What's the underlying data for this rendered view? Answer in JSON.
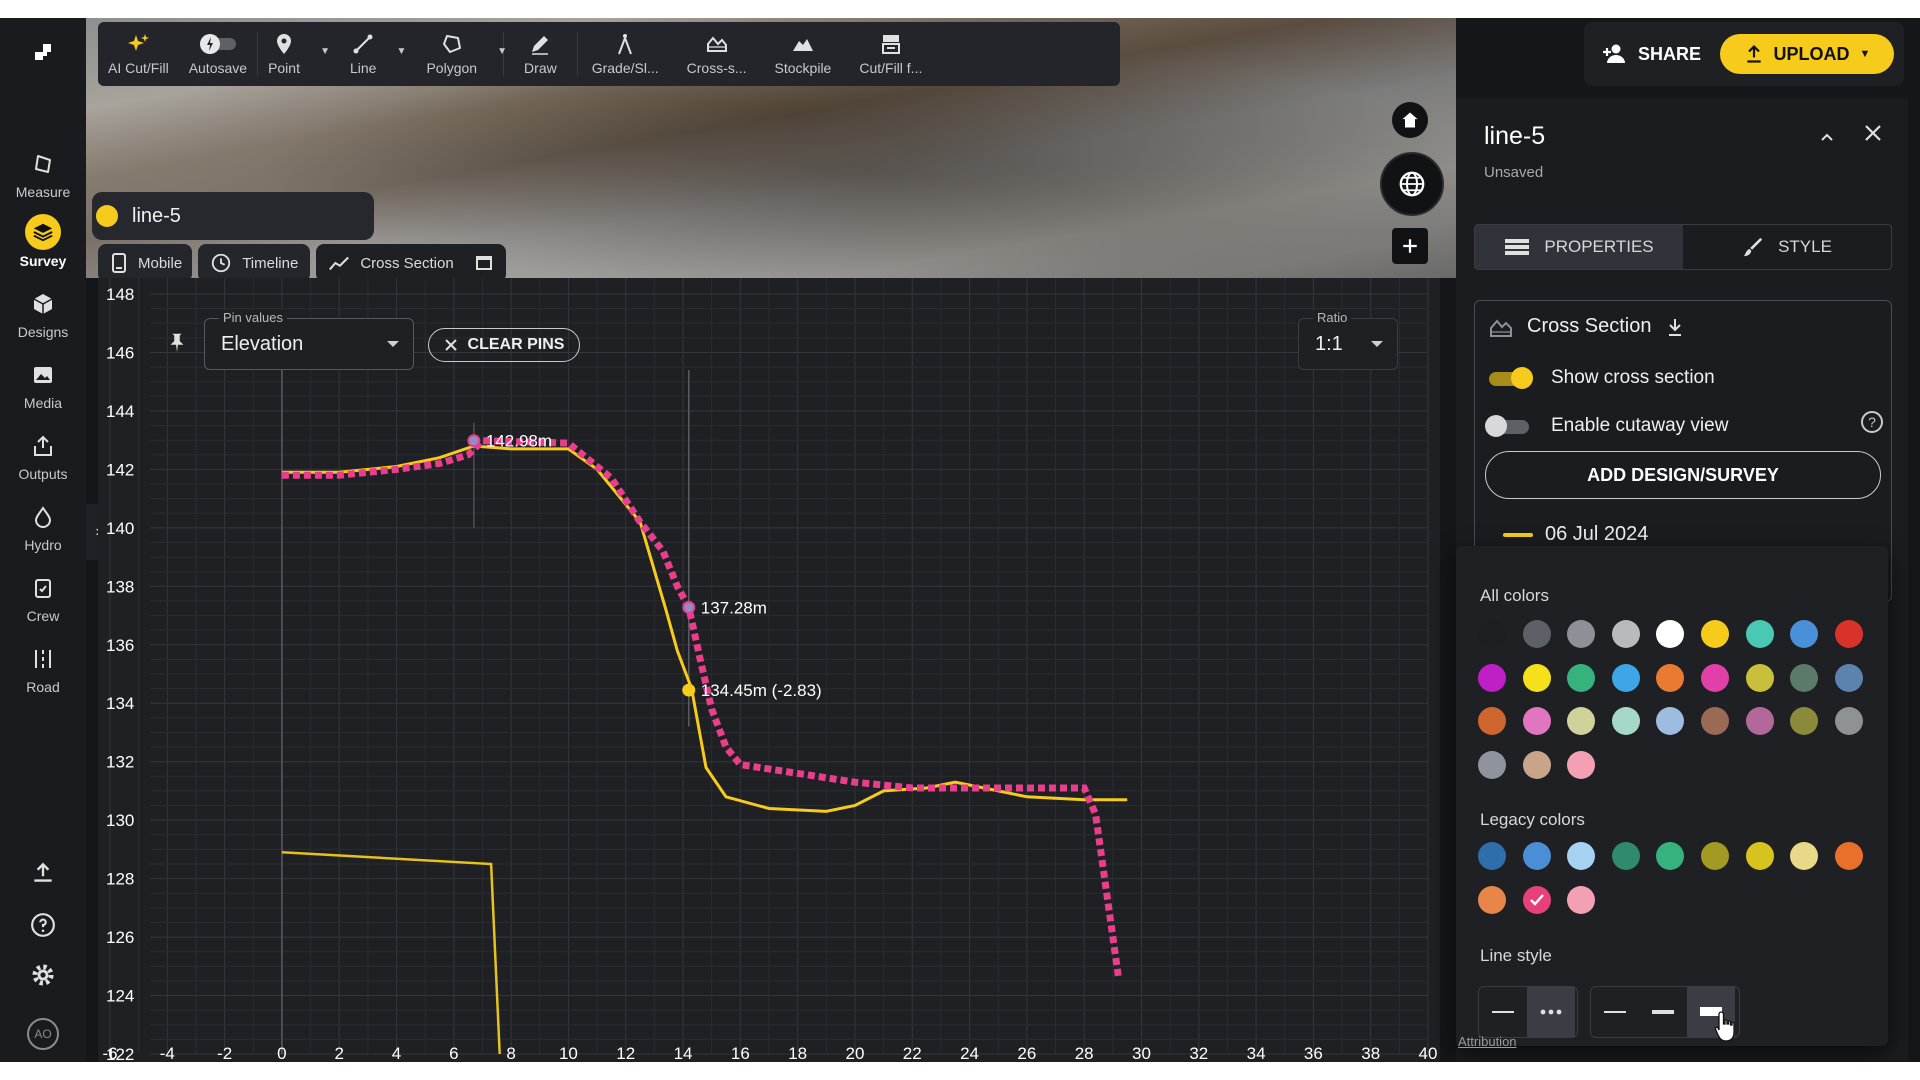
{
  "sidebar": {
    "items": [
      {
        "label": "Measure",
        "icon": "measure-icon"
      },
      {
        "label": "Survey",
        "icon": "survey-layers-icon",
        "active": true
      },
      {
        "label": "Designs",
        "icon": "designs-cube-icon"
      },
      {
        "label": "Media",
        "icon": "media-image-icon"
      },
      {
        "label": "Outputs",
        "icon": "outputs-export-icon"
      },
      {
        "label": "Hydro",
        "icon": "hydro-drop-icon"
      },
      {
        "label": "Crew",
        "icon": "crew-clipboard-icon"
      },
      {
        "label": "Road",
        "icon": "road-icon"
      }
    ],
    "avatar_initials": "AO"
  },
  "toolbar": {
    "tools": [
      {
        "label": "AI Cut/Fill",
        "icon": "sparkle-icon"
      },
      {
        "label": "Autosave",
        "icon": "autosave-toggle-icon"
      },
      {
        "label": "Point",
        "icon": "map-pin-icon"
      },
      {
        "label": "Line",
        "icon": "line-icon"
      },
      {
        "label": "Polygon",
        "icon": "polygon-icon"
      },
      {
        "label": "Draw",
        "icon": "pencil-icon"
      },
      {
        "label": "Grade/Sl...",
        "icon": "compass-icon"
      },
      {
        "label": "Cross-s...",
        "icon": "cross-section-icon"
      },
      {
        "label": "Stockpile",
        "icon": "stockpile-icon"
      },
      {
        "label": "Cut/Fill f...",
        "icon": "cutfill-icon"
      }
    ]
  },
  "header": {
    "share_label": "SHARE",
    "upload_label": "UPLOAD",
    "accent_color": "#f6cb1c"
  },
  "layer": {
    "name": "line-5",
    "color": "#f6cb1c"
  },
  "viewer_tabs": [
    {
      "label": "Mobile",
      "icon": "mobile-icon"
    },
    {
      "label": "Timeline",
      "icon": "clock-icon"
    },
    {
      "label": "Cross Section",
      "icon": "chart-line-icon"
    }
  ],
  "cross_section": {
    "pin_values_label": "Pin values",
    "pin_values_value": "Elevation",
    "clear_pins_label": "CLEAR PINS",
    "ratio_label": "Ratio",
    "ratio_value": "1:1"
  },
  "chart_data": {
    "type": "line",
    "xlim": [
      -6,
      40
    ],
    "ylim": [
      122,
      148
    ],
    "x_ticks": [
      "-6",
      "-4",
      "-2",
      "0",
      "2",
      "4",
      "6",
      "8",
      "10",
      "12",
      "14",
      "16",
      "18",
      "20",
      "22",
      "24",
      "26",
      "28",
      "30",
      "32",
      "34",
      "36",
      "38",
      "40"
    ],
    "y_ticks": [
      "122",
      "124",
      "126",
      "128",
      "130",
      "132",
      "134",
      "136",
      "138",
      "140",
      "142",
      "144",
      "146",
      "148"
    ],
    "grid": true,
    "series": [
      {
        "color": "#f6cb1c",
        "style": "solid",
        "points": [
          [
            0,
            141.9
          ],
          [
            2,
            141.9
          ],
          [
            4,
            142.1
          ],
          [
            5.5,
            142.4
          ],
          [
            6.7,
            142.8
          ],
          [
            8,
            142.7
          ],
          [
            10,
            142.7
          ],
          [
            11,
            142.0
          ],
          [
            12.5,
            140.2
          ],
          [
            13.4,
            137.2
          ],
          [
            13.8,
            135.8
          ],
          [
            14.3,
            134.5
          ],
          [
            14.8,
            131.8
          ],
          [
            15.5,
            130.8
          ],
          [
            17,
            130.4
          ],
          [
            19,
            130.3
          ],
          [
            20,
            130.5
          ],
          [
            21,
            131.0
          ],
          [
            22.5,
            131.1
          ],
          [
            23.5,
            131.3
          ],
          [
            25,
            131.0
          ],
          [
            26,
            130.8
          ],
          [
            28,
            130.7
          ],
          [
            29.5,
            130.7
          ]
        ]
      },
      {
        "color": "#e83e8c",
        "style": "dashed",
        "points": [
          [
            0,
            141.8
          ],
          [
            2,
            141.8
          ],
          [
            4,
            142.0
          ],
          [
            5.5,
            142.2
          ],
          [
            6.5,
            142.5
          ],
          [
            7,
            142.98
          ],
          [
            10,
            142.9
          ],
          [
            11.5,
            141.7
          ],
          [
            12.5,
            140.2
          ],
          [
            13.3,
            139.2
          ],
          [
            13.8,
            138.0
          ],
          [
            14.2,
            137.28
          ],
          [
            14.6,
            135.5
          ],
          [
            15,
            133.8
          ],
          [
            15.5,
            132.5
          ],
          [
            16,
            131.9
          ],
          [
            18,
            131.6
          ],
          [
            20,
            131.3
          ],
          [
            22,
            131.1
          ],
          [
            25,
            131.1
          ],
          [
            28,
            131.1
          ],
          [
            28.4,
            130.2
          ],
          [
            29.2,
            124.6
          ]
        ]
      },
      {
        "color": "#e6c21a",
        "style": "solid",
        "points": [
          [
            0,
            128.9
          ],
          [
            7.3,
            128.5
          ],
          [
            7.6,
            122
          ]
        ]
      }
    ],
    "pins": [
      {
        "x": 6.7,
        "y": 142.98,
        "label": "142.98m",
        "color": "#e83e8c"
      },
      {
        "x": 14.2,
        "y": 137.28,
        "label": "137.28m",
        "color": "#e83e8c"
      },
      {
        "x": 14.2,
        "y": 134.45,
        "label": "134.45m (-2.83)",
        "color": "#f6cb1c"
      }
    ],
    "markers": [
      {
        "x": 0
      },
      {
        "x": 14.2
      }
    ]
  },
  "right_panel": {
    "title": "line-5",
    "subtitle": "Unsaved",
    "tab_properties": "PROPERTIES",
    "tab_style": "STYLE",
    "section_title": "Cross Section",
    "show_cross_section_label": "Show cross section",
    "show_cross_section_on": true,
    "cutaway_label": "Enable cutaway view",
    "cutaway_on": false,
    "add_design_label": "ADD DESIGN/SURVEY",
    "survey_date": "06 Jul 2024"
  },
  "color_picker": {
    "all_colors_label": "All colors",
    "all_colors": [
      "#1d1e22",
      "#5d6066",
      "#8d9096",
      "#b9babd",
      "#ffffff",
      "#f6cb1c",
      "#49c9b3",
      "#4a90d9",
      "#d8322b",
      "#c01ec6",
      "#f4e11c",
      "#35b27e",
      "#3ea5e6",
      "#ea7a32",
      "#e040a8",
      "#c8c03a",
      "#5c7a6a",
      "#5c83ae",
      "#d0662f",
      "#e075c0",
      "#cfd29a",
      "#a5d8c8",
      "#9ebbe0",
      "#9a6a55",
      "#b2699a",
      "#8a8a3a",
      "#8e9294",
      "#8e939e",
      "#c8a48a",
      "#f4a0b4"
    ],
    "legacy_colors_label": "Legacy colors",
    "legacy_colors": [
      "#2f6eac",
      "#4a8fd6",
      "#a4d2f0",
      "#2f8a6e",
      "#35b27e",
      "#a29a22",
      "#d8c21e",
      "#e8d888",
      "#e8702a",
      "#e8864a",
      "#e8407a",
      "#f4a0b4"
    ],
    "selected_legacy_index": 10,
    "line_style_label": "Line style"
  },
  "attribution_label": "Attribution"
}
